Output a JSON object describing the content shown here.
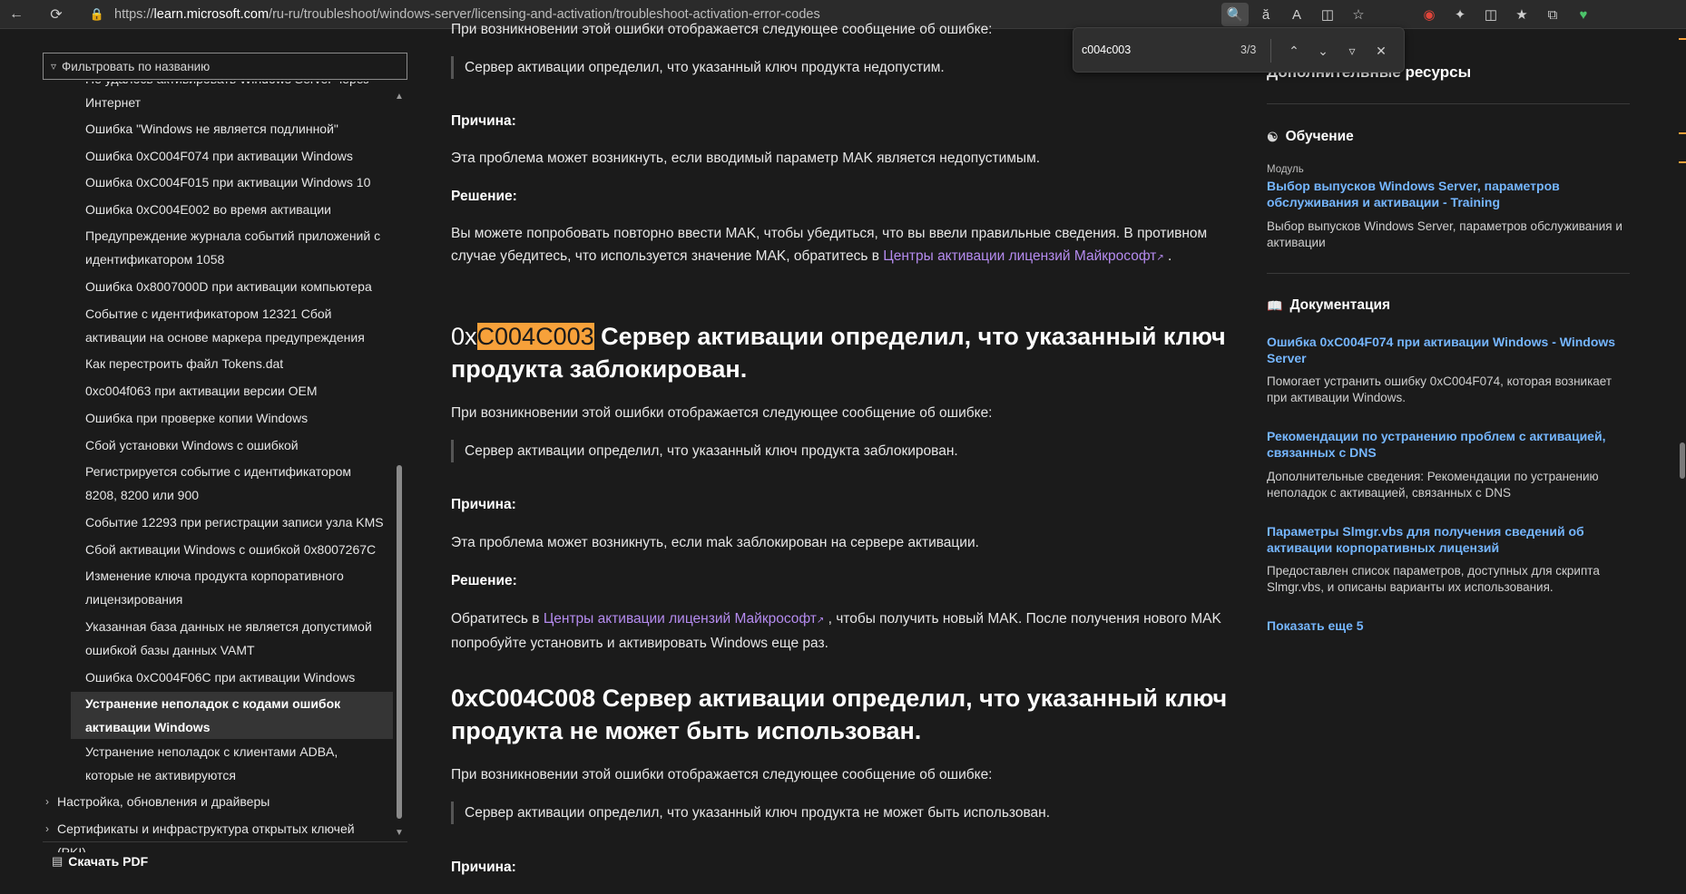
{
  "browser": {
    "url_prefix": "https://",
    "url_host": "learn.microsoft.com",
    "url_path": "/ru-ru/troubleshoot/windows-server/licensing-and-activation/troubleshoot-activation-error-codes"
  },
  "find": {
    "query": "c004c003",
    "count": "3/3"
  },
  "leftnav": {
    "filter_placeholder": "Фильтровать по названию",
    "items": [
      "Не удалось активировать Windows Server через Интернет",
      "Ошибка \"Windows не является подлинной\"",
      "Ошибка 0xC004F074 при активации Windows",
      "Ошибка 0xC004F015 при активации Windows 10",
      "Ошибка 0xC004E002 во время активации",
      "Предупреждение журнала событий приложений с идентификатором 1058",
      "Ошибка 0x8007000D при активации компьютера",
      "Событие с идентификатором 12321 Сбой активации на основе маркера предупреждения",
      "Как перестроить файл Tokens.dat",
      "0xc004f063 при активации версии OEM",
      "Ошибка при проверке копии Windows",
      "Сбой установки Windows с ошибкой",
      "Регистрируется событие с идентификатором 8208, 8200 или 900",
      "Событие 12293 при регистрации записи узла KMS",
      "Сбой активации Windows с ошибкой 0x8007267C",
      "Изменение ключа продукта корпоративного лицензирования",
      "Указанная база данных не является допустимой ошибкой базы данных VAMT",
      "Ошибка 0xC004F06C при активации Windows",
      "Устранение неполадок с кодами ошибок активации Windows",
      "Устранение неполадок с клиентами ADBA, которые не активируются"
    ],
    "groups": [
      "Настройка, обновления и драйверы",
      "Сертификаты и инфраструктура открытых ключей (PKI)"
    ],
    "download": "Скачать PDF"
  },
  "main": {
    "top_partial": "При возникновении этой ошибки отображается следующее сообщение об ошибке:",
    "quote1": "Сервер активации определил, что указанный ключ продукта недопустим.",
    "cause_label": "Причина:",
    "cause1": "Эта проблема может возникнуть, если вводимый параметр MAK является недопустимым.",
    "solution_label": "Решение:",
    "solution1_a": "Вы можете попробовать повторно ввести MAK, чтобы убедиться, что вы ввели правильные сведения. В противном случае убедитесь, что используется значение MAK, обратитесь в ",
    "solution1_link": "Центры активации лицензий Майкрософт",
    "solution1_b": " .",
    "h2a_prefix": "0x",
    "h2a_code": "C004C003",
    "h2a_text": " Сервер активации определил, что указанный ключ продукта заблокирован.",
    "intro2": "При возникновении этой ошибки отображается следующее сообщение об ошибке:",
    "quote2": "Сервер активации определил, что указанный ключ продукта заблокирован.",
    "cause2": "Эта проблема может возникнуть, если mak заблокирован на сервере активации.",
    "solution2_a": "Обратитесь в ",
    "solution2_link": "Центры активации лицензий Майкрософт",
    "solution2_b": " , чтобы получить новый MAK. После получения нового MAK попробуйте установить и активировать Windows еще раз.",
    "h2b": "0xC004C008 Сервер активации определил, что указанный ключ продукта не может быть использован.",
    "intro3": "При возникновении этой ошибки отображается следующее сообщение об ошибке:",
    "quote3": "Сервер активации определил, что указанный ключ продукта не может быть использован."
  },
  "aside": {
    "title": "Дополнительные ресурсы",
    "training_title": "Обучение",
    "module_label": "Модуль",
    "module_link": "Выбор выпусков Windows Server, параметров обслуживания и активации - Training",
    "module_desc": "Выбор выпусков Windows Server, параметров обслуживания и активации",
    "docs_title": "Документация",
    "docs": [
      {
        "title": "Ошибка 0xC004F074 при активации Windows - Windows Server",
        "desc": "Помогает устранить ошибку 0xC004F074, которая возникает при активации Windows."
      },
      {
        "title": "Рекомендации по устранению проблем с активацией, связанных с DNS",
        "desc": "Дополнительные сведения: Рекомендации по устранению неполадок с активацией, связанных с DNS"
      },
      {
        "title": "Параметры Slmgr.vbs для получения сведений об активации корпоративных лицензий",
        "desc": "Предоставлен список параметров, доступных для скрипта Slmgr.vbs, и описаны варианты их использования."
      }
    ],
    "show_more": "Показать еще 5"
  },
  "colors": {
    "background": "#1b1b1b",
    "highlight": "#f7a13a",
    "link_purple": "#b58bef",
    "link_blue": "#75b6ff"
  }
}
